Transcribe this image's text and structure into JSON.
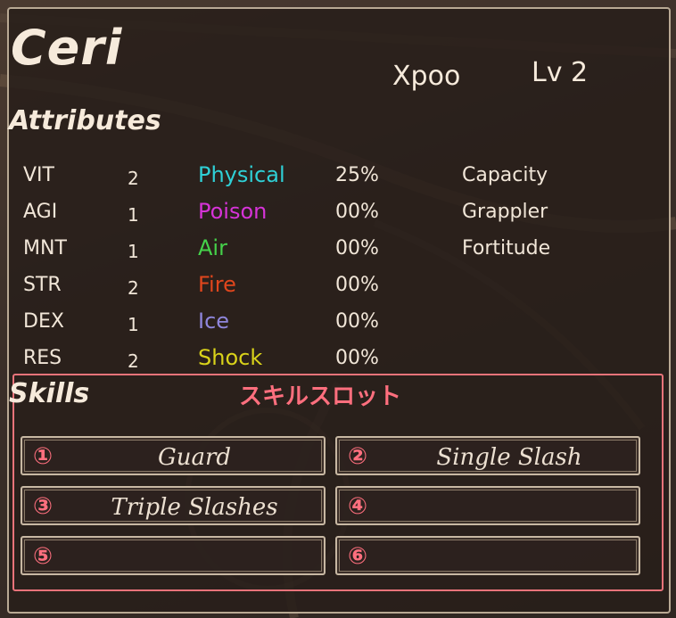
{
  "character": {
    "name": "Ceri",
    "player": "Xpoo",
    "level": "Lv 2"
  },
  "attributes": {
    "heading": "Attributes",
    "stats": [
      {
        "label": "VIT",
        "value": "2"
      },
      {
        "label": "AGI",
        "value": "1"
      },
      {
        "label": "MNT",
        "value": "1"
      },
      {
        "label": "STR",
        "value": "2"
      },
      {
        "label": "DEX",
        "value": "1"
      },
      {
        "label": "RES",
        "value": "2"
      }
    ],
    "resistances": [
      {
        "label": "Physical",
        "value": "25%",
        "color": "#2fd0d6"
      },
      {
        "label": "Poison",
        "value": "00%",
        "color": "#d633d8"
      },
      {
        "label": "Air",
        "value": "00%",
        "color": "#45d14a"
      },
      {
        "label": "Fire",
        "value": "00%",
        "color": "#e0461d"
      },
      {
        "label": "Ice",
        "value": "00%",
        "color": "#8f86dc"
      },
      {
        "label": "Shock",
        "value": "00%",
        "color": "#d9d21a"
      }
    ],
    "traits": [
      "Capacity",
      "Grappler",
      "Fortitude"
    ]
  },
  "skills": {
    "heading": "Skills",
    "annotation": "スキルスロット",
    "slots": [
      {
        "number": "①",
        "name": "Guard"
      },
      {
        "number": "②",
        "name": "Single Slash"
      },
      {
        "number": "③",
        "name": "Triple Slashes"
      },
      {
        "number": "④",
        "name": ""
      },
      {
        "number": "⑤",
        "name": ""
      },
      {
        "number": "⑥",
        "name": ""
      }
    ]
  },
  "colors": {
    "highlight": "#e8737a",
    "annotation_text": "#ff6f7e",
    "panel_border": "#b9a994"
  }
}
